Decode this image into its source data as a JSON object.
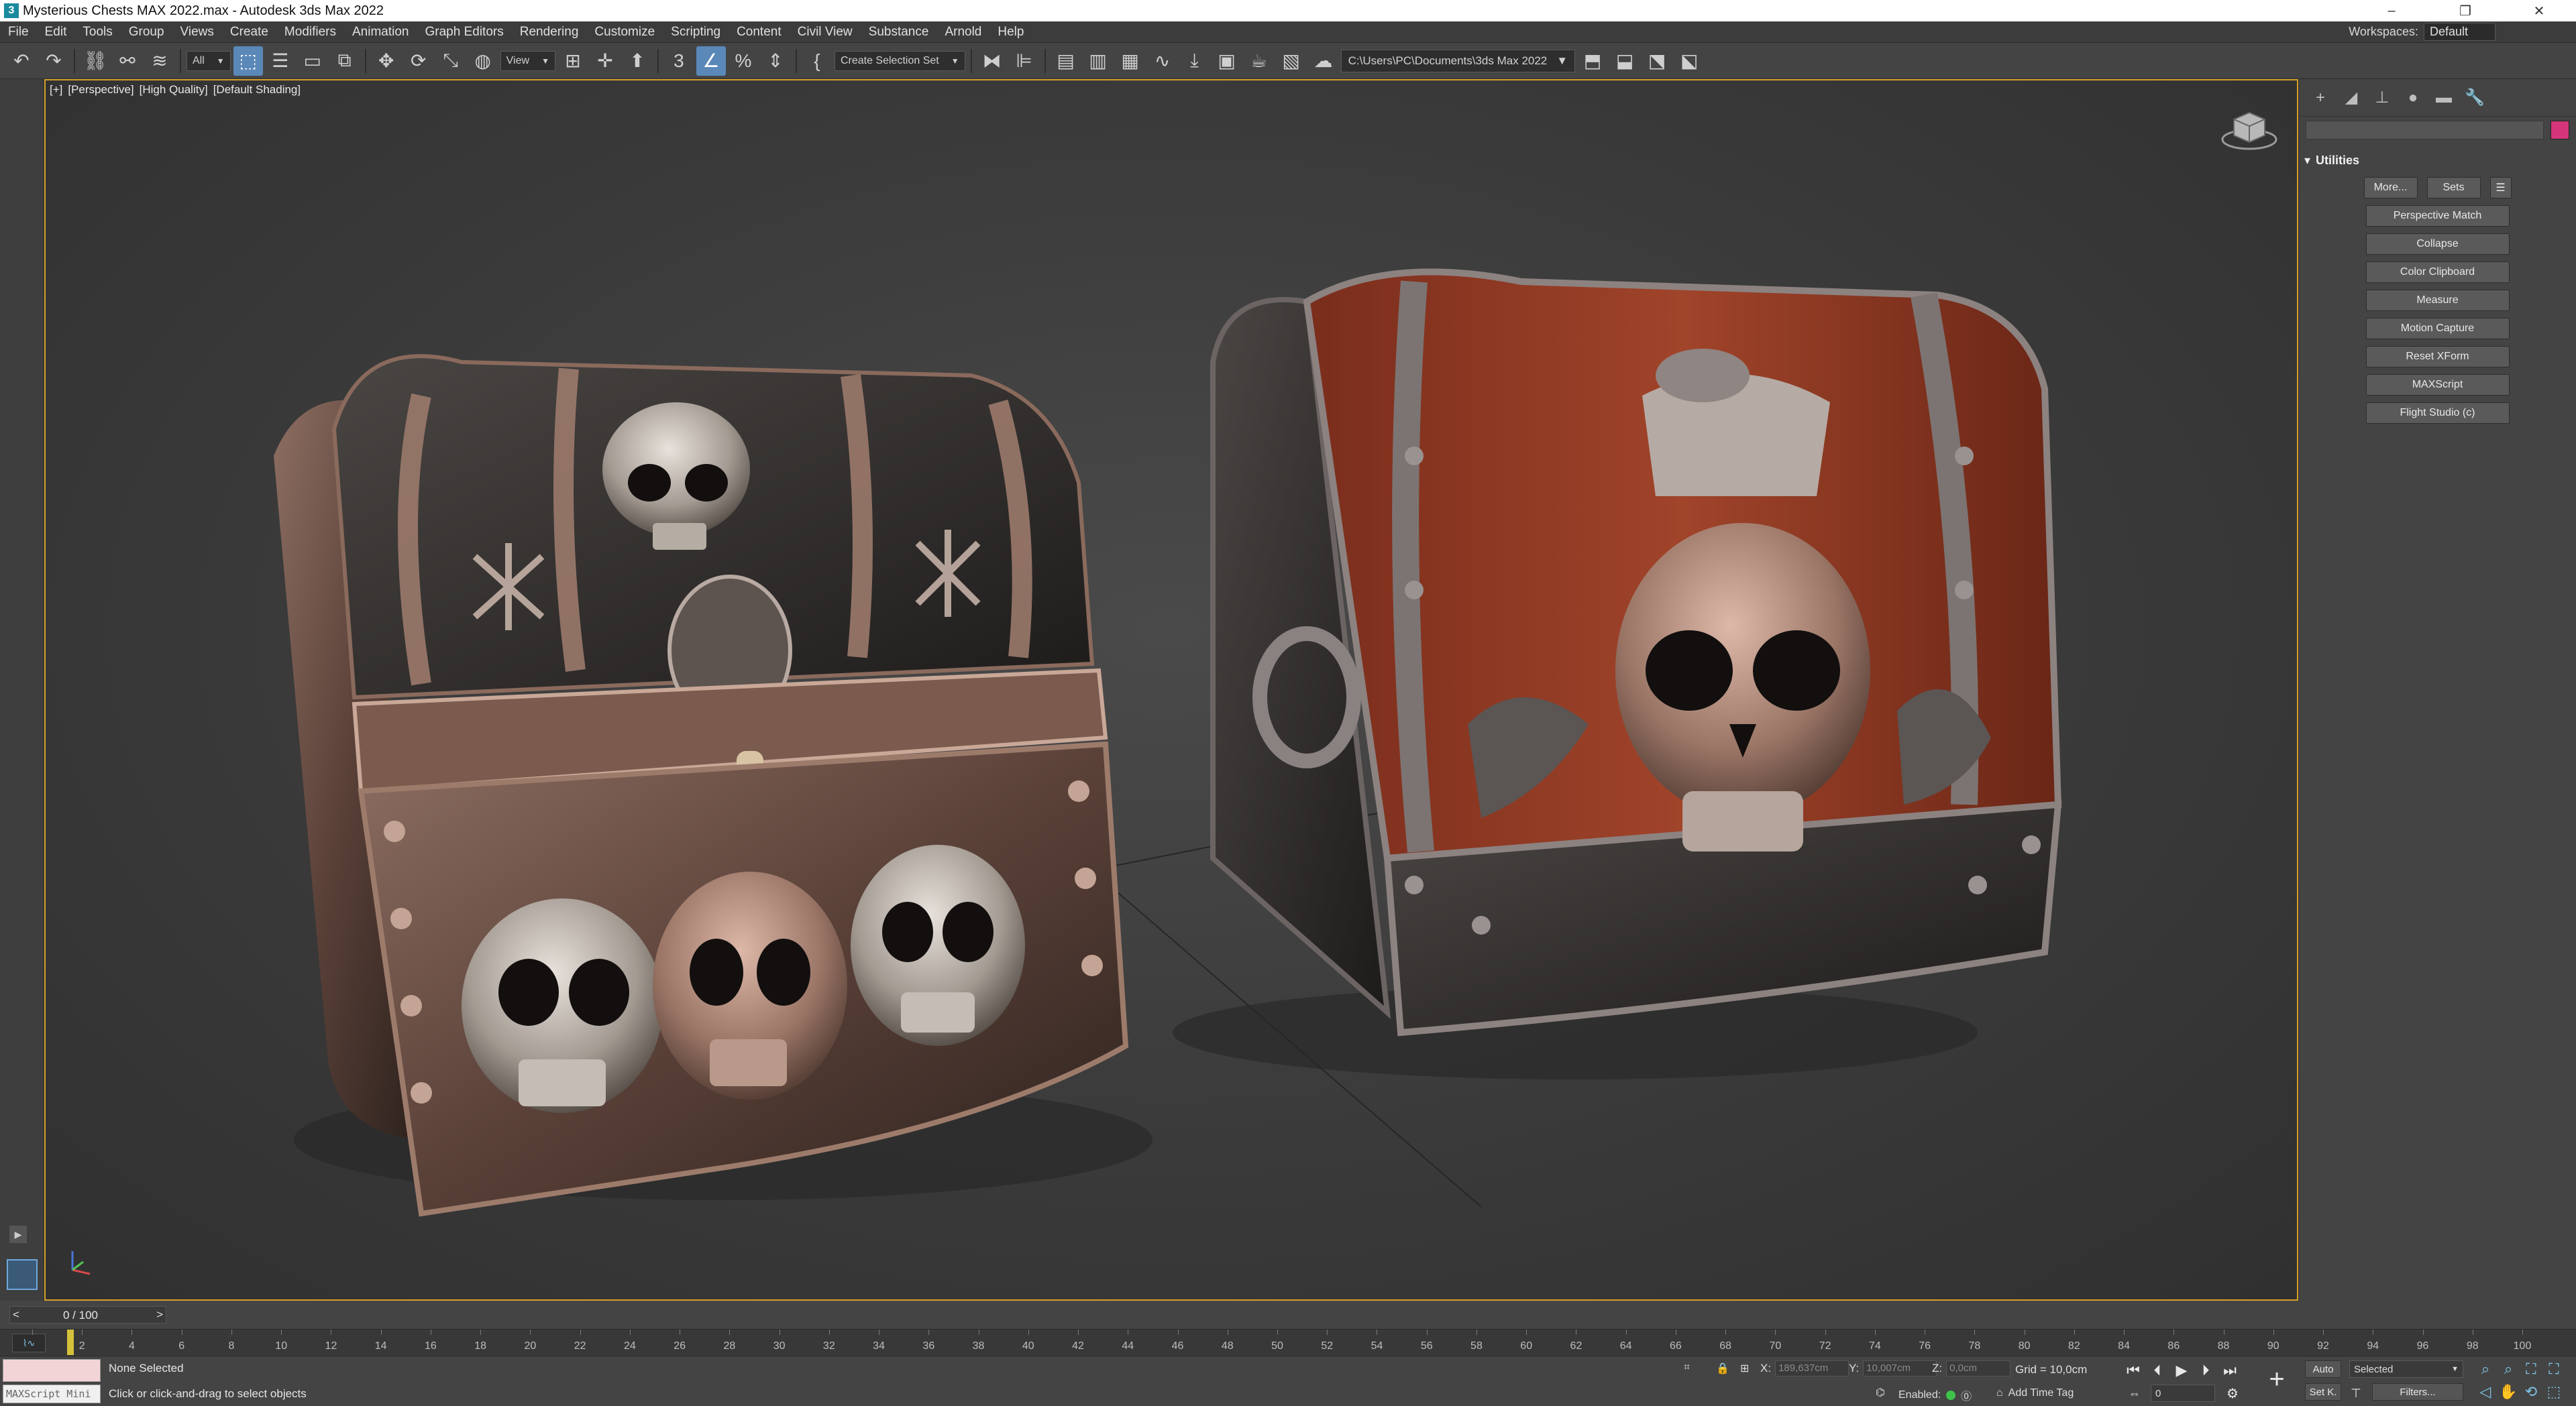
{
  "window": {
    "title": "Mysterious Chests MAX 2022.max - Autodesk 3ds Max 2022",
    "app_icon": "3",
    "minimize": "–",
    "restore": "❐",
    "close": "✕"
  },
  "menu": {
    "items": [
      "File",
      "Edit",
      "Tools",
      "Group",
      "Views",
      "Create",
      "Modifiers",
      "Animation",
      "Graph Editors",
      "Rendering",
      "Customize",
      "Scripting",
      "Content",
      "Civil View",
      "Substance",
      "Arnold",
      "Help"
    ],
    "workspaces_label": "Workspaces:",
    "workspace_value": "Default"
  },
  "toolbar": {
    "selection_filter": "All",
    "ref_coord": "View",
    "selection_set": "Create Selection Set",
    "project_path": "C:\\Users\\PC\\Documents\\3ds Max 2022"
  },
  "viewport": {
    "label_plus": "[+]",
    "label_view": "[Perspective]",
    "label_quality": "[High Quality]",
    "label_shading": "[Default Shading]"
  },
  "command_panel": {
    "rollout_title": "Utilities",
    "more_button": "More...",
    "sets_button": "Sets",
    "buttons": [
      "Perspective Match",
      "Collapse",
      "Color Clipboard",
      "Measure",
      "Motion Capture",
      "Reset XForm",
      "MAXScript",
      "Flight Studio (c)"
    ],
    "object_color": "#d2357a"
  },
  "timeline": {
    "frame_label": "0 / 100",
    "prev": "<",
    "next": ">",
    "ticks": [
      "0",
      "2",
      "4",
      "6",
      "8",
      "10",
      "12",
      "14",
      "16",
      "18",
      "20",
      "22",
      "24",
      "26",
      "28",
      "30",
      "32",
      "34",
      "36",
      "38",
      "40",
      "42",
      "44",
      "46",
      "48",
      "50",
      "52",
      "54",
      "56",
      "58",
      "60",
      "62",
      "64",
      "66",
      "68",
      "70",
      "72",
      "74",
      "76",
      "78",
      "80",
      "82",
      "84",
      "86",
      "88",
      "90",
      "92",
      "94",
      "96",
      "98",
      "100"
    ]
  },
  "status": {
    "maxscript_label": "MAXScript Mini",
    "selection": "None Selected",
    "prompt": "Click or click-and-drag to select objects",
    "x_label": "X:",
    "x_value": "189,637cm",
    "y_label": "Y:",
    "y_value": "10,007cm",
    "z_label": "Z:",
    "z_value": "0,0cm",
    "grid": "Grid = 10,0cm",
    "enabled": "Enabled:",
    "add_time_tag": "Add Time Tag",
    "auto": "Auto",
    "selected": "Selected",
    "set_key": "Set K.",
    "filters": "Filters...",
    "current_frame": "0"
  }
}
